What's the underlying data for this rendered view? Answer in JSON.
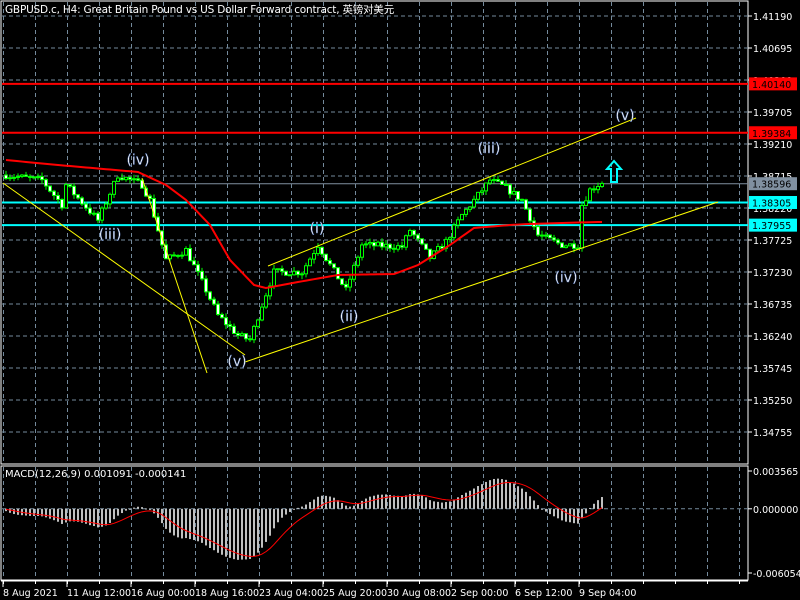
{
  "header": {
    "title": "GBPUSD.c, H4:  Great Britain Pound vs US Dollar Forward contract, 英镑对美元"
  },
  "colors": {
    "background": "#000000",
    "grid": "#748a9c",
    "candle": "#00ff00",
    "ma": "#ff0000",
    "trendline": "#ffff00",
    "resistance": "#ff0000",
    "support": "#00ffff",
    "bid": "#8090a0",
    "macd_hist": "#c0c0c0",
    "macd_signal": "#ff0000"
  },
  "chart_data": {
    "type": "candlestick",
    "symbol": "GBPUSD.c",
    "timeframe": "H4",
    "price_ticks": [
      "1.41190",
      "1.40695",
      "1.40200",
      "1.39705",
      "1.39210",
      "1.38715",
      "1.38220",
      "1.37725",
      "1.37230",
      "1.36735",
      "1.36240",
      "1.35745",
      "1.35250",
      "1.34755"
    ],
    "time_ticks": [
      "8 Aug 2021",
      "11 Aug 12:00",
      "16 Aug 00:00",
      "18 Aug 16:00",
      "23 Aug 04:00",
      "25 Aug 20:00",
      "30 Aug 08:00",
      "2 Sep 00:00",
      "6 Sep 12:00",
      "9 Sep 04:00"
    ],
    "candle_count": 150,
    "close_waypoints": [
      [
        0,
        1.3873
      ],
      [
        9,
        1.3865
      ],
      [
        14,
        1.3827
      ],
      [
        15,
        1.3858
      ],
      [
        23,
        1.3803
      ],
      [
        28,
        1.3873
      ],
      [
        34,
        1.3858
      ],
      [
        36,
        1.3834
      ],
      [
        40,
        1.3742
      ],
      [
        45,
        1.3757
      ],
      [
        50,
        1.3695
      ],
      [
        53,
        1.3656
      ],
      [
        58,
        1.3625
      ],
      [
        61,
        1.3618
      ],
      [
        64,
        1.3672
      ],
      [
        67,
        1.3723
      ],
      [
        74,
        1.3723
      ],
      [
        78,
        1.3765
      ],
      [
        81,
        1.3734
      ],
      [
        85,
        1.3695
      ],
      [
        89,
        1.3765
      ],
      [
        99,
        1.3762
      ],
      [
        101,
        1.3788
      ],
      [
        106,
        1.3745
      ],
      [
        110,
        1.377
      ],
      [
        114,
        1.3811
      ],
      [
        117,
        1.3834
      ],
      [
        121,
        1.3865
      ],
      [
        125,
        1.3853
      ],
      [
        129,
        1.3834
      ],
      [
        133,
        1.378
      ],
      [
        139,
        1.3765
      ],
      [
        143,
        1.3765
      ],
      [
        144,
        1.3827
      ],
      [
        146,
        1.385
      ],
      [
        149,
        1.3862
      ]
    ],
    "moving_average_waypoints": [
      [
        0,
        1.38962
      ],
      [
        13,
        1.38885
      ],
      [
        33,
        1.38777
      ],
      [
        40,
        1.38576
      ],
      [
        45,
        1.38344
      ],
      [
        51,
        1.37957
      ],
      [
        56,
        1.37416
      ],
      [
        62,
        1.37029
      ],
      [
        65,
        1.36982
      ],
      [
        73,
        1.37075
      ],
      [
        83,
        1.37184
      ],
      [
        97,
        1.37199
      ],
      [
        103,
        1.37338
      ],
      [
        111,
        1.37648
      ],
      [
        117,
        1.37911
      ],
      [
        126,
        1.37957
      ],
      [
        131,
        1.37973
      ],
      [
        148,
        1.38004
      ]
    ],
    "horizontal_levels": [
      {
        "label": "1.40140",
        "price": 1.4014,
        "kind": "resistance"
      },
      {
        "label": "1.39384",
        "price": 1.39384,
        "kind": "resistance"
      },
      {
        "label": "1.38596",
        "price": 1.38596,
        "kind": "bid"
      },
      {
        "label": "1.38305",
        "price": 1.38305,
        "kind": "support"
      },
      {
        "label": "1.37955",
        "price": 1.37955,
        "kind": "support"
      }
    ],
    "trendlines": [
      [
        [
          -0.75,
          1.38607
        ],
        [
          59.75,
          1.35946
        ]
      ],
      [
        [
          34,
          1.38684
        ],
        [
          50.25,
          1.35668
        ]
      ],
      [
        [
          59.75,
          1.35838
        ],
        [
          178,
          1.38313
        ]
      ],
      [
        [
          65.5,
          1.37323
        ],
        [
          157.5,
          1.39612
        ]
      ]
    ],
    "wave_labels": [
      {
        "text": "(iv)",
        "index": 33,
        "price": 1.38969
      },
      {
        "text": "(iii)",
        "index": 26,
        "price": 1.37818
      },
      {
        "text": "(v)",
        "index": 57.75,
        "price": 1.35853
      },
      {
        "text": "(i)",
        "index": 77.75,
        "price": 1.37911
      },
      {
        "text": "(ii)",
        "index": 85.75,
        "price": 1.3655
      },
      {
        "text": "(iii)",
        "index": 120.75,
        "price": 1.39148
      },
      {
        "text": "(iv)",
        "index": 140,
        "price": 1.37153
      },
      {
        "text": "(v)",
        "index": 154.75,
        "price": 1.39659
      }
    ],
    "up_arrow": {
      "index": 152,
      "price": 1.38777
    },
    "macd": {
      "title": "MACD(12,26,9) 0.001091 -0.000141",
      "ticks": [
        "0.003565",
        "0.000000",
        "-0.006054"
      ],
      "range": [
        -0.006054,
        0.003565
      ],
      "fast": 12,
      "slow": 26,
      "signal": 9
    }
  }
}
